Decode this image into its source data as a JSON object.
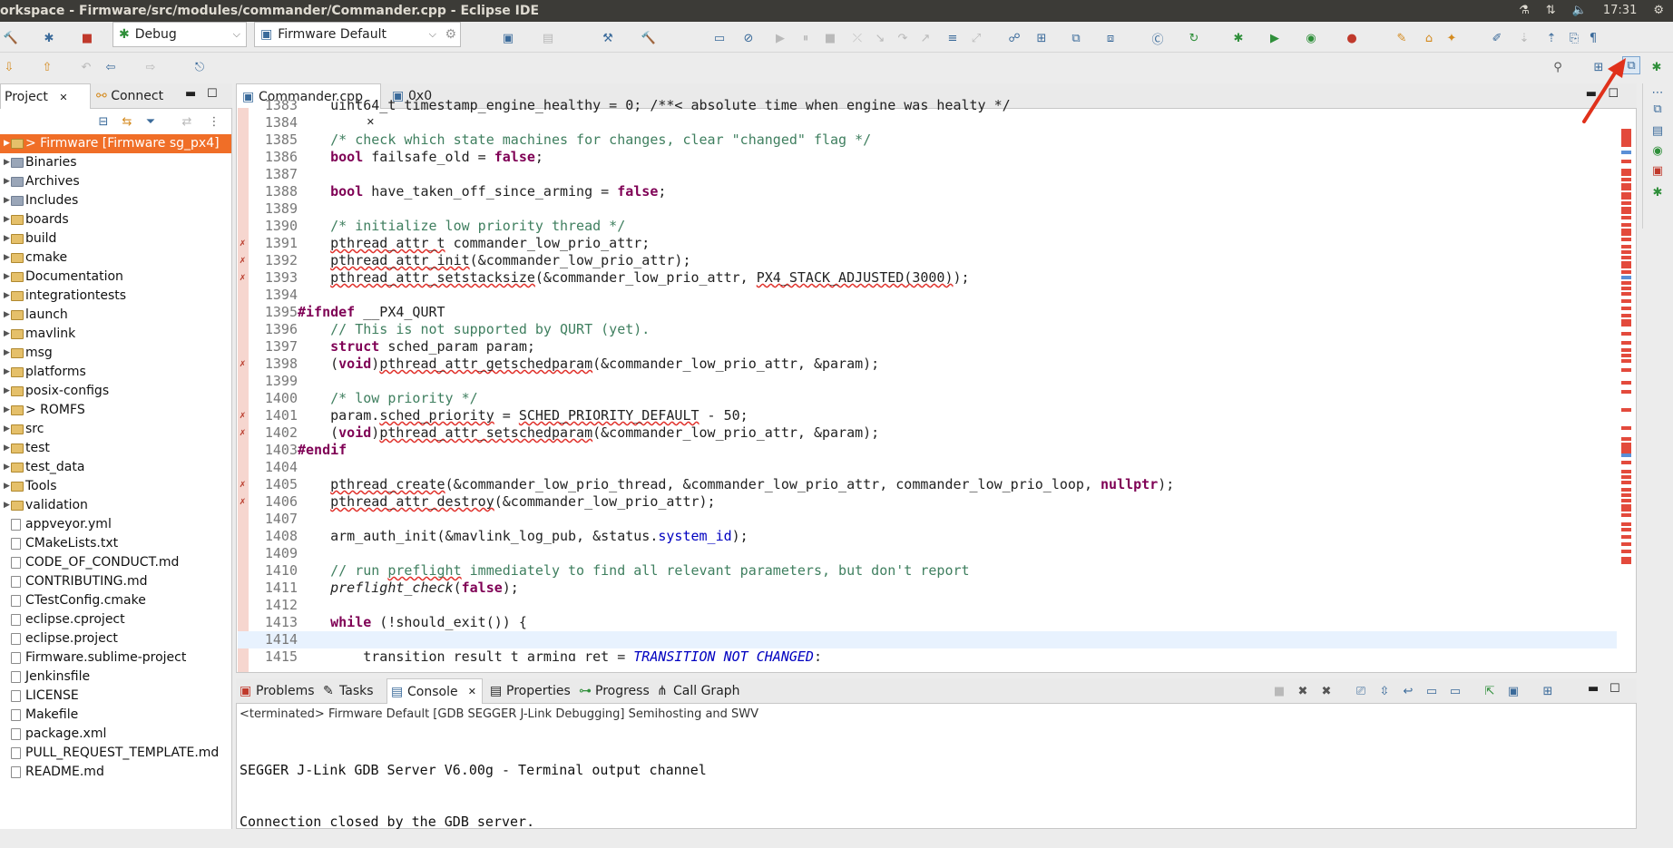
{
  "titlebar": {
    "title": "orkspace - Firmware/src/modules/commander/Commander.cpp - Eclipse IDE",
    "clock": "17:31"
  },
  "toolbar": {
    "launch_mode": "Debug",
    "launch_config": "Firmware Default"
  },
  "project_pane": {
    "tabs": [
      {
        "label": "Project"
      },
      {
        "label": "Connect"
      }
    ],
    "items": [
      {
        "label": "> Firmware [Firmware sg_px4]",
        "selected": true,
        "kind": "project"
      },
      {
        "label": "Binaries",
        "kind": "bin"
      },
      {
        "label": "Archives",
        "kind": "bin"
      },
      {
        "label": "Includes",
        "kind": "bin"
      },
      {
        "label": "boards",
        "kind": "folder"
      },
      {
        "label": "build",
        "kind": "folder"
      },
      {
        "label": "cmake",
        "kind": "folder"
      },
      {
        "label": "Documentation",
        "kind": "folder"
      },
      {
        "label": "integrationtests",
        "kind": "folder"
      },
      {
        "label": "launch",
        "kind": "folder"
      },
      {
        "label": "mavlink",
        "kind": "folder"
      },
      {
        "label": "msg",
        "kind": "folder"
      },
      {
        "label": "platforms",
        "kind": "folder"
      },
      {
        "label": "posix-configs",
        "kind": "folder"
      },
      {
        "label": "> ROMFS",
        "kind": "folder"
      },
      {
        "label": "src",
        "kind": "folder"
      },
      {
        "label": "test",
        "kind": "folder"
      },
      {
        "label": "test_data",
        "kind": "folder"
      },
      {
        "label": "Tools",
        "kind": "folder"
      },
      {
        "label": "validation",
        "kind": "folder"
      },
      {
        "label": "appveyor.yml",
        "kind": "file"
      },
      {
        "label": "CMakeLists.txt",
        "kind": "file"
      },
      {
        "label": "CODE_OF_CONDUCT.md",
        "kind": "file"
      },
      {
        "label": "CONTRIBUTING.md",
        "kind": "file"
      },
      {
        "label": "CTestConfig.cmake",
        "kind": "file"
      },
      {
        "label": "eclipse.cproject",
        "kind": "file"
      },
      {
        "label": "eclipse.project",
        "kind": "file"
      },
      {
        "label": "Firmware.sublime-project",
        "kind": "file"
      },
      {
        "label": "Jenkinsfile",
        "kind": "file"
      },
      {
        "label": "LICENSE",
        "kind": "file"
      },
      {
        "label": "Makefile",
        "kind": "file"
      },
      {
        "label": "package.xml",
        "kind": "file"
      },
      {
        "label": "PULL_REQUEST_TEMPLATE.md",
        "kind": "file"
      },
      {
        "label": "README.md",
        "kind": "file"
      }
    ]
  },
  "editor": {
    "tabs": [
      {
        "label": "Commander.cpp"
      },
      {
        "label": "0x0"
      }
    ],
    "lines": [
      {
        "n": "1383",
        "html": "    uint64_t timestamp_engine_healthy = 0; /**< absolute time when engine was healty */"
      },
      {
        "n": "1384",
        "html": ""
      },
      {
        "n": "1385",
        "html": "    <span class='cm'>/* check which state machines for changes, clear \"changed\" flag */</span>"
      },
      {
        "n": "1386",
        "html": "    <span class='kw'>bool</span> failsafe_old = <span class='kw'>false</span>;"
      },
      {
        "n": "1387",
        "html": ""
      },
      {
        "n": "1388",
        "html": "    <span class='kw'>bool</span> have_taken_off_since_arming = <span class='kw'>false</span>;"
      },
      {
        "n": "1389",
        "html": ""
      },
      {
        "n": "1390",
        "html": "    <span class='cm'>/* initialize low priority thread */</span>"
      },
      {
        "n": "1391",
        "html": "    <span class='sq'>pthread_attr_t</span> commander_low_prio_attr;",
        "err": true
      },
      {
        "n": "1392",
        "html": "    <span class='sq'>pthread_attr_init</span>(&amp;commander_low_prio_attr);",
        "err": true
      },
      {
        "n": "1393",
        "html": "    <span class='sq'>pthread_attr_setstacksize</span>(&amp;commander_low_prio_attr, <span class='sq'>PX4_STACK_ADJUSTED(3000)</span>);",
        "err": true
      },
      {
        "n": "1394",
        "html": ""
      },
      {
        "n": "1395",
        "html": "<span class='pp'>#ifndef</span> __PX4_QURT"
      },
      {
        "n": "1396",
        "html": "    <span class='cm'>// This is not supported by QURT (yet).</span>"
      },
      {
        "n": "1397",
        "html": "    <span class='kw'>struct</span> sched_param param;"
      },
      {
        "n": "1398",
        "html": "    (<span class='kw'>void</span>)<span class='sq'>pthread_attr_getschedparam</span>(&amp;commander_low_prio_attr, &amp;param);",
        "err": true
      },
      {
        "n": "1399",
        "html": ""
      },
      {
        "n": "1400",
        "html": "    <span class='cm'>/* low priority */</span>"
      },
      {
        "n": "1401",
        "html": "    param.<span class='sq'>sched_priority</span> = <span class='sq'>SCHED_PRIORITY_DEFAULT</span> - 50;",
        "err": true
      },
      {
        "n": "1402",
        "html": "    (<span class='kw'>void</span>)<span class='sq'>pthread_attr_setschedparam</span>(&amp;commander_low_prio_attr, &amp;param);",
        "err": true
      },
      {
        "n": "1403",
        "html": "<span class='pp'>#endif</span>"
      },
      {
        "n": "1404",
        "html": ""
      },
      {
        "n": "1405",
        "html": "    <span class='sq'>pthread_create</span>(&amp;commander_low_prio_thread, &amp;commander_low_prio_attr, commander_low_prio_loop, <span class='kw'>nullptr</span>);",
        "err": true
      },
      {
        "n": "1406",
        "html": "    <span class='sq'>pthread_attr_destroy</span>(&amp;commander_low_prio_attr);",
        "err": true
      },
      {
        "n": "1407",
        "html": ""
      },
      {
        "n": "1408",
        "html": "    arm_auth_init(&amp;mavlink_log_pub, &amp;status.<span class='fld'>system_id</span>);"
      },
      {
        "n": "1409",
        "html": ""
      },
      {
        "n": "1410",
        "html": "    <span class='cm'>// run <span class='sq'>preflight</span> immediately to find all relevant parameters, but don't report</span>"
      },
      {
        "n": "1411",
        "html": "    <span class='it'>preflight_check</span>(<span class='kw'>false</span>);"
      },
      {
        "n": "1412",
        "html": ""
      },
      {
        "n": "1413",
        "html": "    <span class='kw'>while</span> (!should_exit()) {"
      },
      {
        "n": "1414",
        "html": "",
        "cur": true
      },
      {
        "n": "1415",
        "html": "        transition_result_t arming_ret = <span class='cst'>TRANSITION_NOT_CHANGED</span>;"
      }
    ]
  },
  "bottom": {
    "tabs": [
      {
        "label": "Problems"
      },
      {
        "label": "Tasks"
      },
      {
        "label": "Console"
      },
      {
        "label": "Properties"
      },
      {
        "label": "Progress"
      },
      {
        "label": "Call Graph"
      }
    ],
    "console_header": "<terminated> Firmware Default [GDB SEGGER J-Link Debugging] Semihosting and SWV",
    "console_lines": [
      "SEGGER J-Link GDB Server V6.00g - Terminal output channel",
      "Connection closed by the GDB server."
    ]
  },
  "colors": {
    "selection": "#f06e27",
    "keyword": "#7f0055",
    "comment": "#3f7f5f",
    "error": "#e0312b",
    "titlebar": "#3c3b37"
  }
}
